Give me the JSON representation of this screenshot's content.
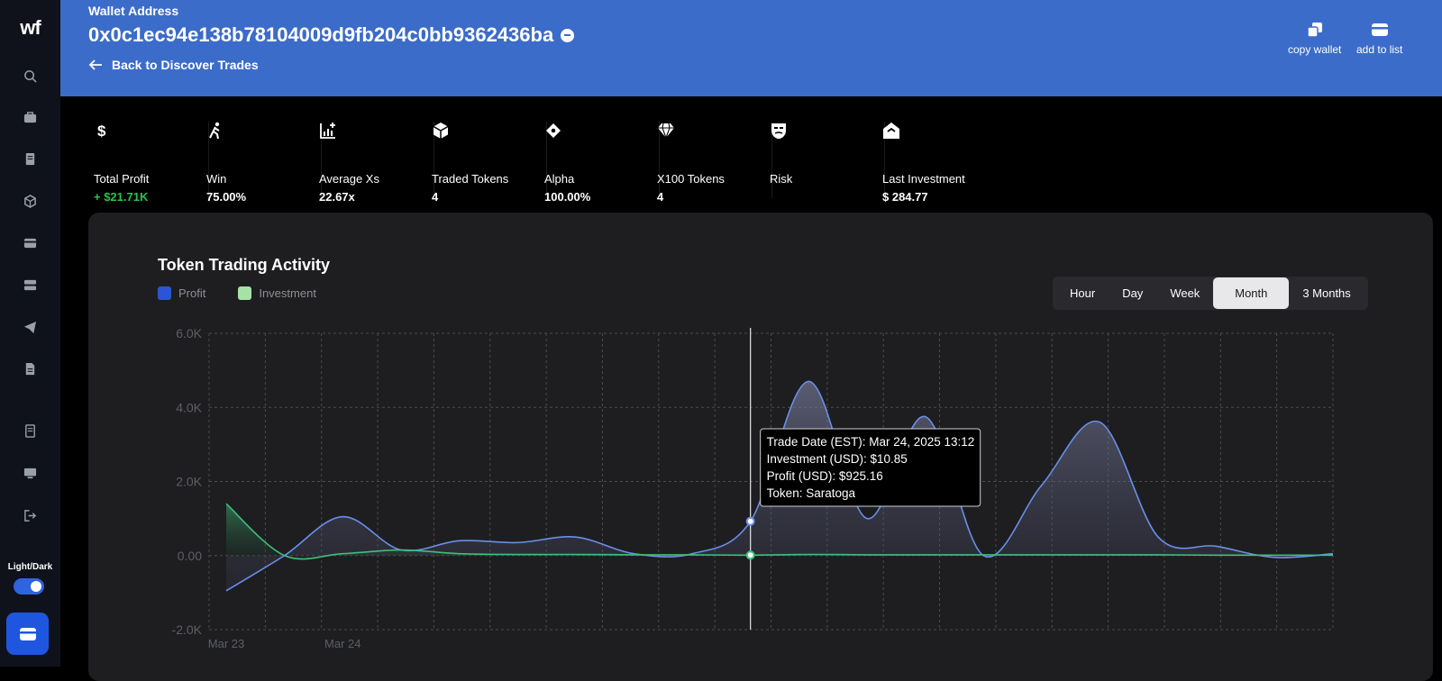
{
  "sidebar": {
    "logo": "wf",
    "theme_label": "Light/Dark"
  },
  "header": {
    "label": "Wallet Address",
    "address": "0x0c1ec94e138b78104009d9fb204c0bb9362436ba",
    "back_label": "Back to Discover Trades",
    "actions": [
      {
        "label": "copy wallet",
        "icon": "copy-icon"
      },
      {
        "label": "add to list",
        "icon": "wallet-icon"
      }
    ]
  },
  "stats": [
    {
      "icon": "dollar-icon",
      "label": "Total Profit",
      "value": "+ $21.71K",
      "positive": true
    },
    {
      "icon": "runner-icon",
      "label": "Win",
      "value": "75.00%"
    },
    {
      "icon": "chart-plus-icon",
      "label": "Average Xs",
      "value": "22.67x"
    },
    {
      "icon": "cube-icon",
      "label": "Traded Tokens",
      "value": "4"
    },
    {
      "icon": "diamond-dot-icon",
      "label": "Alpha",
      "value": "100.00%"
    },
    {
      "icon": "gem-icon",
      "label": "X100 Tokens",
      "value": "4"
    },
    {
      "icon": "mask-icon",
      "label": "Risk",
      "value": ""
    },
    {
      "icon": "house-icon",
      "label": "Last Investment",
      "value": "$ 284.77"
    }
  ],
  "chart_section": {
    "tabs": [
      "Hour",
      "Day",
      "Week",
      "Month",
      "3 Months"
    ],
    "active_tab": "Month",
    "tooltip": [
      "Trade Date (EST): Mar 24, 2025 13:12",
      "Investment (USD): $10.85",
      "Profit (USD): $925.16",
      "Token: Saratoga"
    ]
  },
  "chart_data": {
    "type": "area",
    "title": "Token Trading Activity",
    "legend_position": "top-left",
    "grid": true,
    "series": [
      {
        "name": "Profit",
        "color": "#2b55d4",
        "line_color": "#6a8fea",
        "values": [
          -950,
          0,
          1050,
          150,
          400,
          350,
          500,
          50,
          50,
          925,
          4700,
          1000,
          3750,
          0,
          1900,
          3600,
          500,
          250,
          -50,
          50
        ]
      },
      {
        "name": "Investment",
        "color": "#a6e1a6",
        "line_color": "#3fbf7a",
        "values": [
          1400,
          0,
          50,
          150,
          50,
          30,
          30,
          20,
          20,
          10.85,
          30,
          20,
          20,
          20,
          20,
          20,
          20,
          10,
          10,
          10
        ]
      }
    ],
    "x_tick_labels": [
      "Mar 23",
      "Mar 24"
    ],
    "y_ticks": [
      "6.0K",
      "4.0K",
      "2.0K",
      "0.00",
      "-2.0K"
    ],
    "ylim": [
      -2000,
      6000
    ],
    "hover_index": 9
  }
}
